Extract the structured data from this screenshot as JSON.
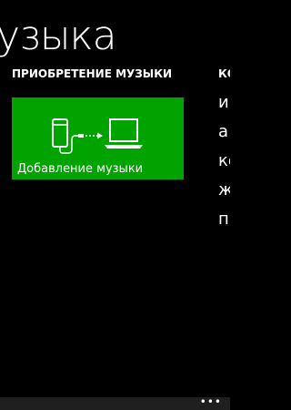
{
  "hub": {
    "title": "узыка"
  },
  "sections": {
    "left_header": "ПРИОБРЕТЕНИЕ МУЗЫКИ",
    "right_header": "КО"
  },
  "tile": {
    "label": "Добавление музыки",
    "color": "#00a300",
    "icon": "phone-to-laptop-sync-icon"
  },
  "right_list": {
    "items": [
      "и",
      "а",
      "ко",
      "ж",
      "п"
    ]
  },
  "app_bar": {
    "more_label": "•••"
  }
}
